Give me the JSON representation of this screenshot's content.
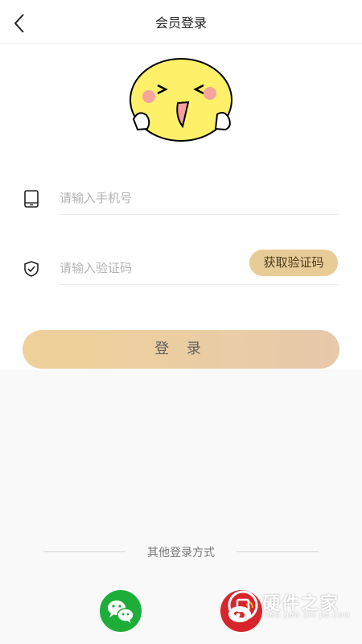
{
  "header": {
    "title": "会员登录"
  },
  "form": {
    "phone_placeholder": "请输入手机号",
    "code_placeholder": "请输入验证码",
    "get_code_label": "获取验证码",
    "login_label": "登 录"
  },
  "other": {
    "title": "其他登录方式"
  },
  "watermark": {
    "text": "硬件之家",
    "sub": "YING JIAN ZHI JIA.COM"
  },
  "colors": {
    "accent": "#e8cc98",
    "wechat": "#1fad3a",
    "weibo": "#d8252c"
  }
}
